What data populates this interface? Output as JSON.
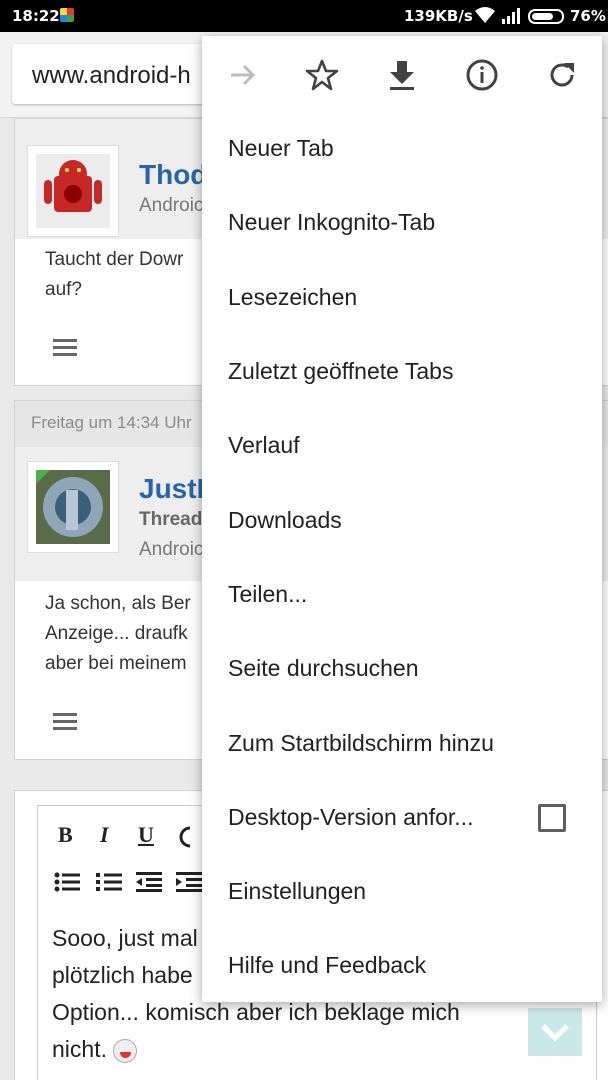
{
  "status_bar": {
    "time": "18:22",
    "net_speed": "139KB/s",
    "battery_pct": "76%",
    "battery_level": 0.76
  },
  "browser": {
    "url": "www.android-h"
  },
  "forum": {
    "post1": {
      "author": "Thod",
      "subtitle": "Androic",
      "text_lines": [
        "Taucht der Dowr",
        "auf?"
      ]
    },
    "post2": {
      "timestamp": "Freitag um 14:34 Uhr",
      "author": "JustD",
      "role": "Thread",
      "subtitle": "Androic",
      "text_lines": [
        "Ja schon, als Ber",
        "Anzeige... draufk",
        "aber bei meinem"
      ]
    },
    "editor": {
      "bold": "B",
      "italic": "I",
      "underline": "U",
      "text_lines": [
        "Sooo, just mal",
        "plötzlich habe",
        "Option... komisch aber ich beklage mich",
        "nicht."
      ]
    }
  },
  "menu": {
    "icons": [
      "forward-icon",
      "star-icon",
      "download-icon",
      "info-icon",
      "reload-icon"
    ],
    "items": [
      {
        "label": "Neuer Tab"
      },
      {
        "label": "Neuer Inkognito-Tab"
      },
      {
        "label": "Lesezeichen"
      },
      {
        "label": "Zuletzt geöffnete Tabs"
      },
      {
        "label": "Verlauf"
      },
      {
        "label": "Downloads"
      },
      {
        "label": "Teilen..."
      },
      {
        "label": "Seite durchsuchen"
      },
      {
        "label": "Zum Startbildschirm hinzu"
      },
      {
        "label": "Desktop-Version anfor..."
      },
      {
        "label": "Einstellungen"
      },
      {
        "label": "Hilfe und Feedback"
      }
    ]
  }
}
